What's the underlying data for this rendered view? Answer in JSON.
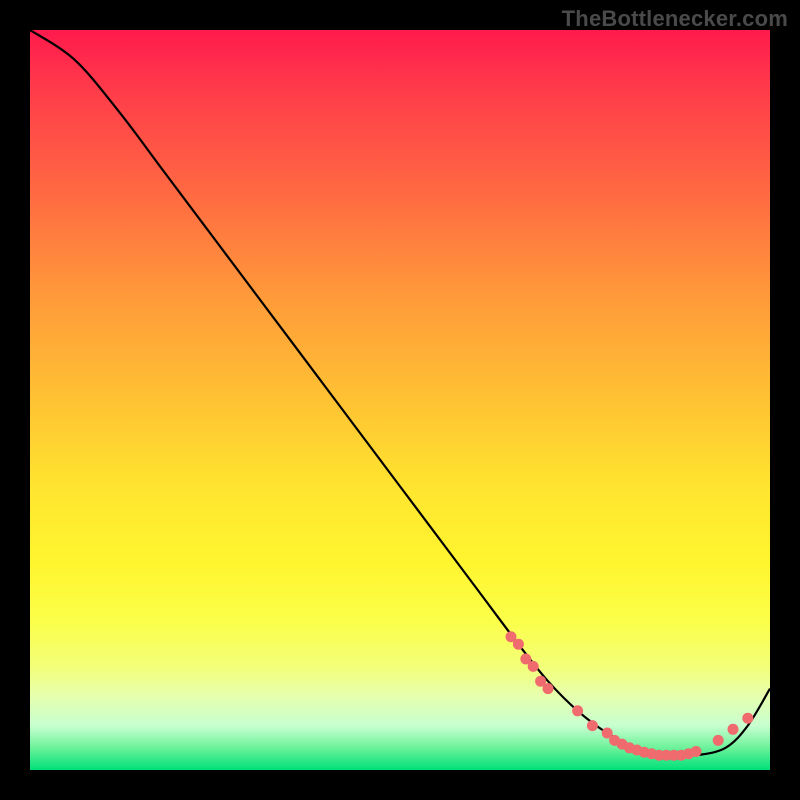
{
  "attribution": "TheBottlenecker.com",
  "chart_data": {
    "type": "line",
    "title": "",
    "xlabel": "",
    "ylabel": "",
    "xlim": [
      0,
      100
    ],
    "ylim": [
      0,
      100
    ],
    "series": [
      {
        "name": "curve",
        "x": [
          0,
          6,
          12,
          18,
          24,
          30,
          36,
          42,
          48,
          54,
          60,
          66,
          70,
          74,
          78,
          82,
          86,
          90,
          94,
          97,
          100
        ],
        "y": [
          100,
          96,
          89,
          81,
          73,
          65,
          57,
          49,
          41,
          33,
          25,
          17,
          12,
          8,
          5,
          3,
          2,
          2,
          3,
          6,
          11
        ]
      }
    ],
    "markers": {
      "name": "highlight-dots",
      "color": "#ef6b6d",
      "points_x": [
        65,
        66,
        67,
        68,
        69,
        70,
        74,
        76,
        78,
        79,
        80,
        81,
        82,
        83,
        84,
        85,
        86,
        87,
        88,
        89,
        90,
        93,
        95,
        97
      ],
      "points_y": [
        18,
        17,
        15,
        14,
        12,
        11,
        8,
        6,
        5,
        4,
        3.5,
        3,
        2.7,
        2.4,
        2.2,
        2,
        2,
        2,
        2,
        2.2,
        2.5,
        4,
        5.5,
        7
      ]
    },
    "background_gradient": {
      "top": "#ff1a4d",
      "mid_top": "#ffc233",
      "mid_bottom": "#fff52f",
      "bottom": "#00e07a"
    }
  }
}
